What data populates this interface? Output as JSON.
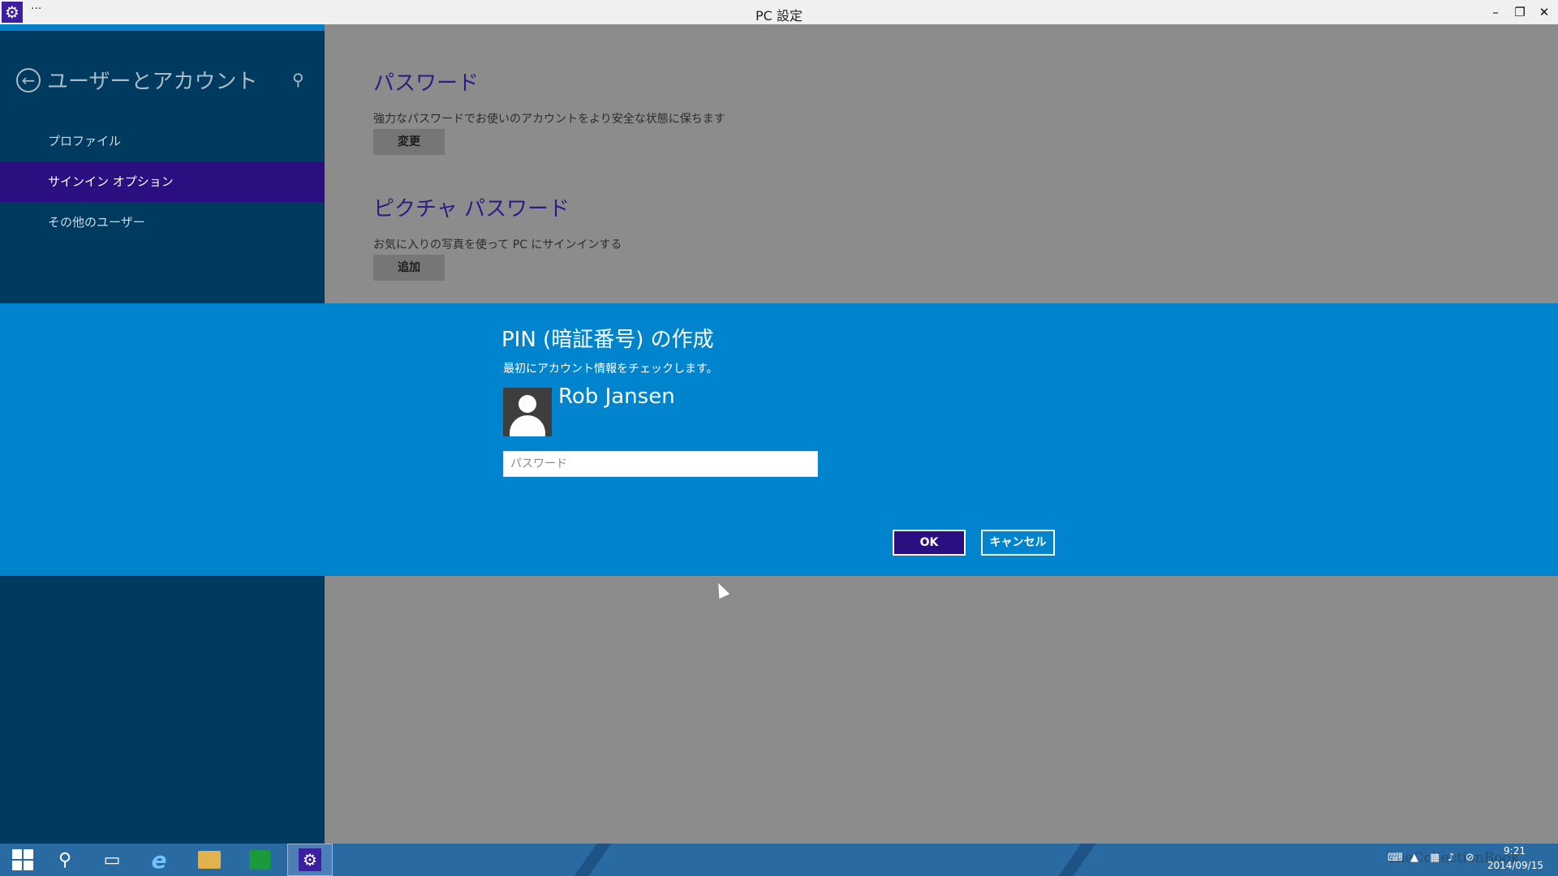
{
  "window": {
    "title": "PC 設定",
    "menu_label": "···",
    "minimize": "–",
    "maximize": "❐",
    "close": "✕"
  },
  "sidebar": {
    "title": "ユーザーとアカウント",
    "items": [
      {
        "label": "プロファイル",
        "selected": false
      },
      {
        "label": "サインイン オプション",
        "selected": true
      },
      {
        "label": "その他のユーザー",
        "selected": false
      }
    ]
  },
  "content": {
    "password": {
      "title": "パスワード",
      "description": "強力なパスワードでお使いのアカウントをより安全な状態に保ちます",
      "button": "変更"
    },
    "picture_password": {
      "title": "ピクチャ パスワード",
      "description": "お気に入りの写真を使って PC にサインインする",
      "button": "追加"
    }
  },
  "dialog": {
    "title": "PIN (暗証番号) の作成",
    "subtitle": "最初にアカウント情報をチェックします。",
    "user_name": "Rob Jansen",
    "password_placeholder": "パスワード",
    "password_value": "",
    "ok_label": "OK",
    "cancel_label": "キャンセル"
  },
  "taskbar": {
    "clock_time": "9:21",
    "clock_date": "2014/09/15",
    "watermark": "TheCollectionBook"
  },
  "colors": {
    "sidebar": "#003a5e",
    "selected": "#2b0e7f",
    "dialog": "#0084cd",
    "content": "#8c8c8c",
    "taskbar": "#2a6aa3"
  },
  "icons": {
    "app": "gear-icon",
    "back": "back-arrow-icon",
    "search": "search-icon",
    "avatar": "user-avatar-icon"
  }
}
